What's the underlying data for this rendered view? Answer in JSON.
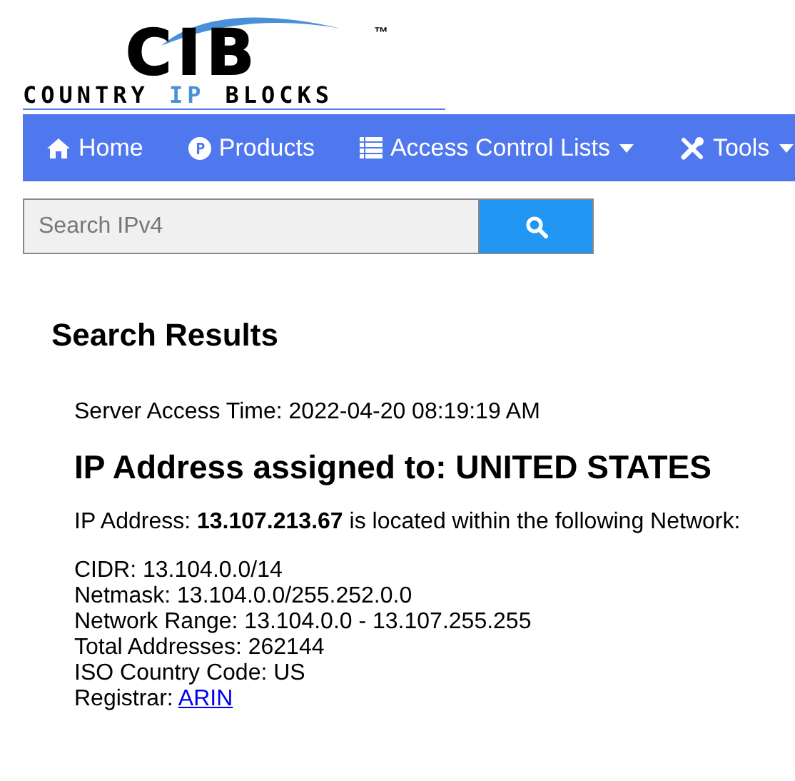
{
  "logo": {
    "mark": "CIB",
    "tm": "™",
    "name": [
      {
        "text": "COUNTRY",
        "highlight": false
      },
      {
        "text": "IP",
        "highlight": true
      },
      {
        "text": "BLOCKS",
        "highlight": false
      }
    ]
  },
  "nav": [
    {
      "label": "Home",
      "kind": "home",
      "dropdown": false
    },
    {
      "label": "Products",
      "kind": "products",
      "dropdown": false
    },
    {
      "label": "Access Control Lists",
      "kind": "lists",
      "dropdown": true
    },
    {
      "label": "Tools",
      "kind": "tools",
      "dropdown": true
    }
  ],
  "search": {
    "placeholder": "Search IPv4"
  },
  "results": {
    "heading": "Search Results",
    "access_time": "Server Access Time: 2022-04-20 08:19:19 AM",
    "title": "IP Address assigned to: UNITED STATES",
    "ip_line": "IP Address: **13.107.213.67** is located within the following Network:",
    "details": [
      "CIDR: 13.104.0.0/14",
      "Netmask: 13.104.0.0/255.252.0.0",
      "Network Range: 13.104.0.0 - 13.107.255.255",
      "Total Addresses: 262144",
      "ISO Country Code: US"
    ],
    "registrar_label": "Registrar:",
    "registrar_link": "ARIN"
  }
}
